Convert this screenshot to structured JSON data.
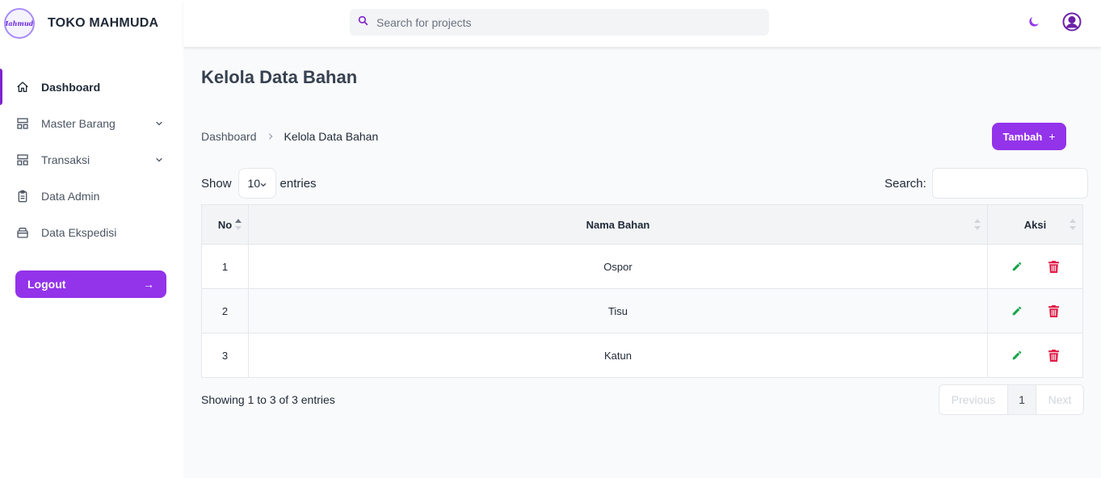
{
  "brand": {
    "name": "TOKO MAHMUDA",
    "logo_text": "Mahmuda"
  },
  "sidebar": {
    "items": [
      {
        "label": "Dashboard",
        "icon": "home-icon"
      },
      {
        "label": "Master Barang",
        "icon": "grid-icon"
      },
      {
        "label": "Transaksi",
        "icon": "grid-icon"
      },
      {
        "label": "Data Admin",
        "icon": "clipboard-icon"
      },
      {
        "label": "Data Ekspedisi",
        "icon": "briefcase-icon"
      }
    ],
    "logout": {
      "label": "Logout",
      "arrow": "→"
    }
  },
  "topbar": {
    "search_placeholder": "Search for projects"
  },
  "page": {
    "title": "Kelola Data Bahan"
  },
  "breadcrumb": {
    "home": "Dashboard",
    "current": "Kelola Data Bahan"
  },
  "add_button": {
    "label": "Tambah",
    "plus": "+"
  },
  "table_controls": {
    "show": "Show",
    "page_size": "10",
    "entries": "entries",
    "search_label": "Search:"
  },
  "table": {
    "headers": [
      "No",
      "Nama Bahan",
      "Aksi"
    ],
    "rows": [
      {
        "no": "1",
        "nama": "Ospor"
      },
      {
        "no": "2",
        "nama": "Tisu"
      },
      {
        "no": "3",
        "nama": "Katun"
      }
    ]
  },
  "footer": {
    "info": "Showing 1 to 3 of 3 entries",
    "previous": "Previous",
    "current_page": "1",
    "next": "Next"
  },
  "colors": {
    "accent": "#9333ea",
    "edit": "#16a34a",
    "delete": "#e11d48"
  }
}
